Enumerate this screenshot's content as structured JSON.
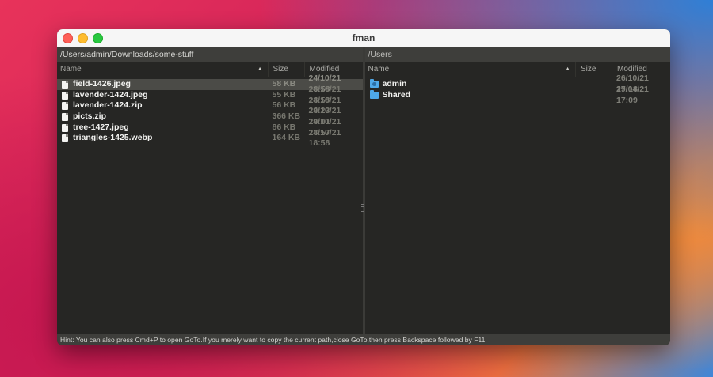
{
  "window": {
    "title": "fman"
  },
  "left_pane": {
    "path": "/Users/admin/Downloads/some-stuff",
    "columns": {
      "name": "Name",
      "size": "Size",
      "modified": "Modified"
    },
    "rows": [
      {
        "name": "field-1426.jpeg",
        "size": "58 KB",
        "modified": "24/10/21 18:58",
        "icon": "file-icon"
      },
      {
        "name": "lavender-1424.jpeg",
        "size": "55 KB",
        "modified": "24/10/21 18:58",
        "icon": "file-icon"
      },
      {
        "name": "lavender-1424.zip",
        "size": "56 KB",
        "modified": "24/10/21 19:23",
        "icon": "file-icon"
      },
      {
        "name": "picts.zip",
        "size": "366 KB",
        "modified": "24/10/21 19:01",
        "icon": "file-icon"
      },
      {
        "name": "tree-1427.jpeg",
        "size": "86 KB",
        "modified": "24/10/21 18:57",
        "icon": "file-icon"
      },
      {
        "name": "triangles-1425.webp",
        "size": "164 KB",
        "modified": "24/10/21 18:58",
        "icon": "file-icon"
      }
    ]
  },
  "right_pane": {
    "path": "/Users",
    "columns": {
      "name": "Name",
      "size": "Size",
      "modified": "Modified"
    },
    "rows": [
      {
        "name": "admin",
        "size": "",
        "modified": "26/10/21 17:18",
        "icon": "user-folder-icon"
      },
      {
        "name": "Shared",
        "size": "",
        "modified": "29/04/21 17:09",
        "icon": "folder-icon"
      }
    ]
  },
  "status": {
    "hint": "Hint: You can also press Cmd+P to open GoTo.If you merely want to copy the current path,close GoTo,then press Backspace followed by F11."
  },
  "colors": {
    "selection": "#4b4b47",
    "folder": "#4fa8e8",
    "background": "#262624"
  }
}
